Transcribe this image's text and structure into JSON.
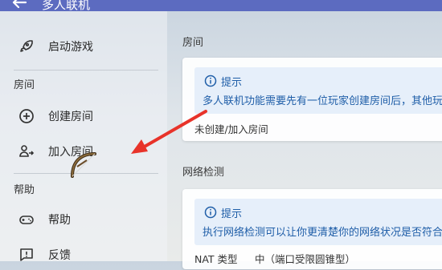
{
  "header": {
    "title": "多人联机",
    "back_icon": "arrow-left-icon"
  },
  "sidebar": {
    "launch": {
      "label": "启动游戏",
      "icon": "rocket-icon"
    },
    "room_header": "房间",
    "create_room": {
      "label": "创建房间",
      "icon": "plus-circle-icon"
    },
    "join_room": {
      "label": "加入房间",
      "icon": "user-join-icon"
    },
    "help_header": "帮助",
    "help": {
      "label": "帮助",
      "icon": "gamepad-icon"
    },
    "feedback": {
      "label": "反馈",
      "icon": "feedback-icon"
    }
  },
  "main": {
    "room": {
      "title": "房间",
      "hint_title": "提示",
      "hint_text": "多人联机功能需要先有一位玩家创建房间后，其他玩",
      "status": "未创建/加入房间"
    },
    "network": {
      "title": "网络检测",
      "hint_title": "提示",
      "hint_text": "执行网络检测可以让你更清楚你的网络状况是否符合",
      "nat_label": "NAT 类型",
      "nat_value": "中（端口受限圆锥型）"
    }
  },
  "colors": {
    "accent": "#5c6bc0",
    "hint_bg": "#e6effa",
    "hint_text": "#1f5ea8",
    "arrow": "#e8332a"
  }
}
